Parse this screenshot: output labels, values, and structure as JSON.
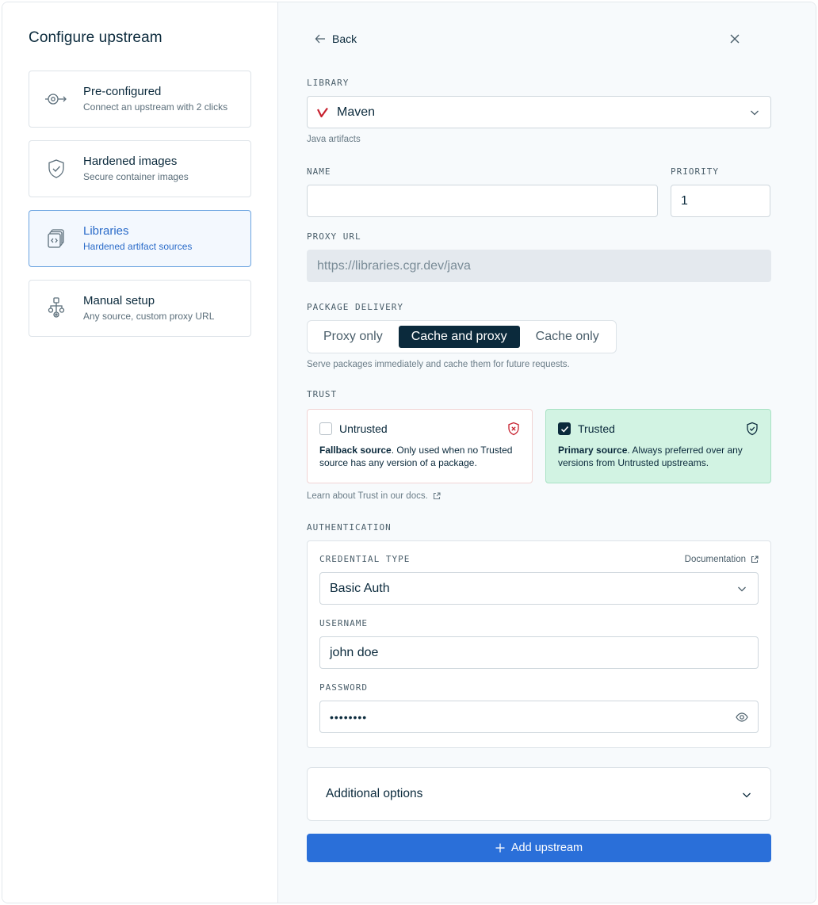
{
  "left": {
    "title": "Configure upstream",
    "options": [
      {
        "title": "Pre-configured",
        "subtitle": "Connect an upstream with 2 clicks",
        "icon": "preconfigured-icon",
        "active": false
      },
      {
        "title": "Hardened images",
        "subtitle": "Secure container images",
        "icon": "shield-check-icon",
        "active": false
      },
      {
        "title": "Libraries",
        "subtitle": "Hardened artifact sources",
        "icon": "libraries-icon",
        "active": true
      },
      {
        "title": "Manual setup",
        "subtitle": "Any source, custom proxy URL",
        "icon": "flow-icon",
        "active": false
      }
    ]
  },
  "header": {
    "back_label": "Back",
    "close_icon": "close-icon"
  },
  "library": {
    "label": "LIBRARY",
    "value": "Maven",
    "hint": "Java artifacts",
    "brand_color": "#c7202e"
  },
  "name": {
    "label": "NAME",
    "value": ""
  },
  "priority": {
    "label": "PRIORITY",
    "value": "1"
  },
  "proxy_url": {
    "label": "PROXY URL",
    "value": "https://libraries.cgr.dev/java"
  },
  "delivery": {
    "label": "PACKAGE DELIVERY",
    "options": [
      "Proxy only",
      "Cache and proxy",
      "Cache only"
    ],
    "selected": "Cache and proxy",
    "hint": "Serve packages immediately and cache them for future requests."
  },
  "trust": {
    "label": "TRUST",
    "untrusted": {
      "title": "Untrusted",
      "desc_bold": "Fallback source",
      "desc": ". Only used when no Trusted source has any version of a package.",
      "checked": false
    },
    "trusted": {
      "title": "Trusted",
      "desc_bold": "Primary source",
      "desc": ". Always preferred over any versions from Untrusted upstreams.",
      "checked": true
    },
    "learn": "Learn about Trust in our docs."
  },
  "auth": {
    "label": "AUTHENTICATION",
    "credential_label": "CREDENTIAL TYPE",
    "doc_link": "Documentation",
    "credential_value": "Basic Auth",
    "username_label": "USERNAME",
    "username_value": "john doe",
    "password_label": "PASSWORD",
    "password_value": "••••••••"
  },
  "additional": {
    "label": "Additional options"
  },
  "submit": {
    "label": "Add upstream"
  },
  "colors": {
    "accent": "#2a6fd9",
    "dark": "#0b2a3c",
    "trusted_bg": "#d2f3e3",
    "untrusted_icon": "#c7202e"
  }
}
